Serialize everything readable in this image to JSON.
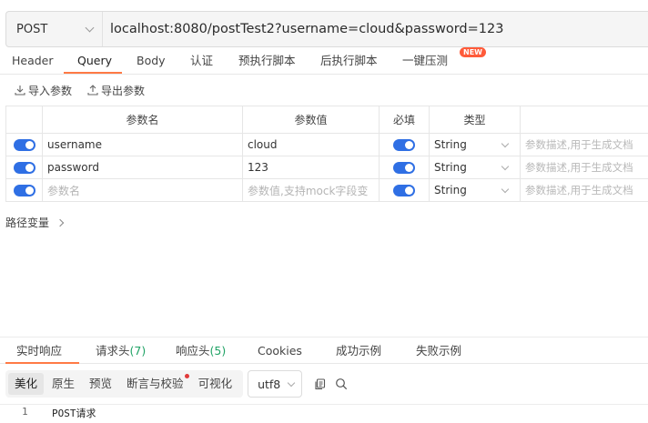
{
  "request": {
    "method": "POST",
    "url": "localhost:8080/postTest2?username=cloud&password=123"
  },
  "tabs": [
    {
      "label": "Header"
    },
    {
      "label": "Query",
      "active": true
    },
    {
      "label": "Body"
    },
    {
      "label": "认证"
    },
    {
      "label": "预执行脚本"
    },
    {
      "label": "后执行脚本"
    },
    {
      "label": "一键压测",
      "badge": "NEW"
    }
  ],
  "params": {
    "import_label": "导入参数",
    "export_label": "导出参数",
    "headers": [
      "参数名",
      "参数值",
      "必填",
      "类型"
    ],
    "rows": [
      {
        "enabled": true,
        "name": "username",
        "value": "cloud",
        "required": true,
        "type": "String",
        "description": "参数描述,用于生成文档"
      },
      {
        "enabled": true,
        "name": "password",
        "value": "123",
        "required": true,
        "type": "String",
        "description": "参数描述,用于生成文档"
      }
    ],
    "new_row": {
      "enabled": true,
      "name_placeholder": "参数名",
      "value_placeholder": "参数值,支持mock字段变",
      "required": true,
      "type": "String",
      "description": "参数描述,用于生成文档"
    },
    "path_vars_label": "路径变量"
  },
  "response": {
    "tabs": {
      "live": "实时响应",
      "req_headers": "请求头",
      "req_headers_count": "(7)",
      "resp_headers": "响应头",
      "resp_headers_count": "(5)",
      "cookies": "Cookies",
      "success_example": "成功示例",
      "fail_example": "失败示例"
    },
    "view_modes": [
      "美化",
      "原生",
      "预览",
      "断言与校验",
      "可视化"
    ],
    "active_view": "美化",
    "encoding": "utf8",
    "lines": [
      {
        "no": "1",
        "text": "POST请求"
      }
    ]
  },
  "colors": {
    "accent": "#ff7a45",
    "toggle_on": "#2f6fe4",
    "count_green": "#21a366",
    "badge_red": "#ff5b3a"
  }
}
